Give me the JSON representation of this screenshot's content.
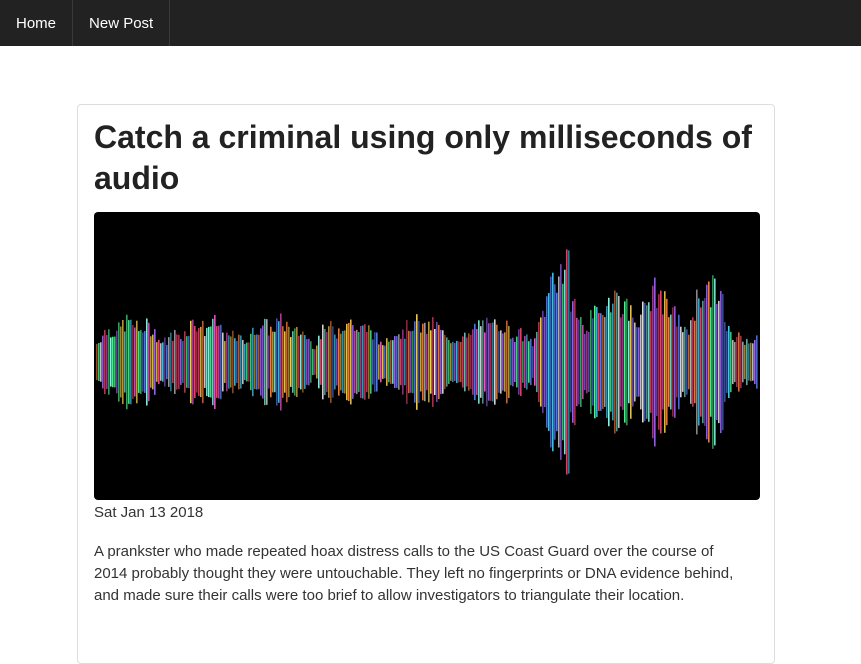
{
  "navbar": {
    "home_label": "Home",
    "new_post_label": "New Post",
    "background": "#222222"
  },
  "post": {
    "title": "Catch a criminal using only milliseconds of audio",
    "date": "Sat Jan 13 2018",
    "body": "A prankster who made repeated hoax distress calls to the US Coast Guard over the course of 2014 probably thought they were untouchable. They left no fingerprints or DNA evidence behind, and made sure their calls were too brief to allow investigators to triangulate their location."
  },
  "hero_image": {
    "subject": "colorful-audio-waveform",
    "background": "#000000"
  }
}
